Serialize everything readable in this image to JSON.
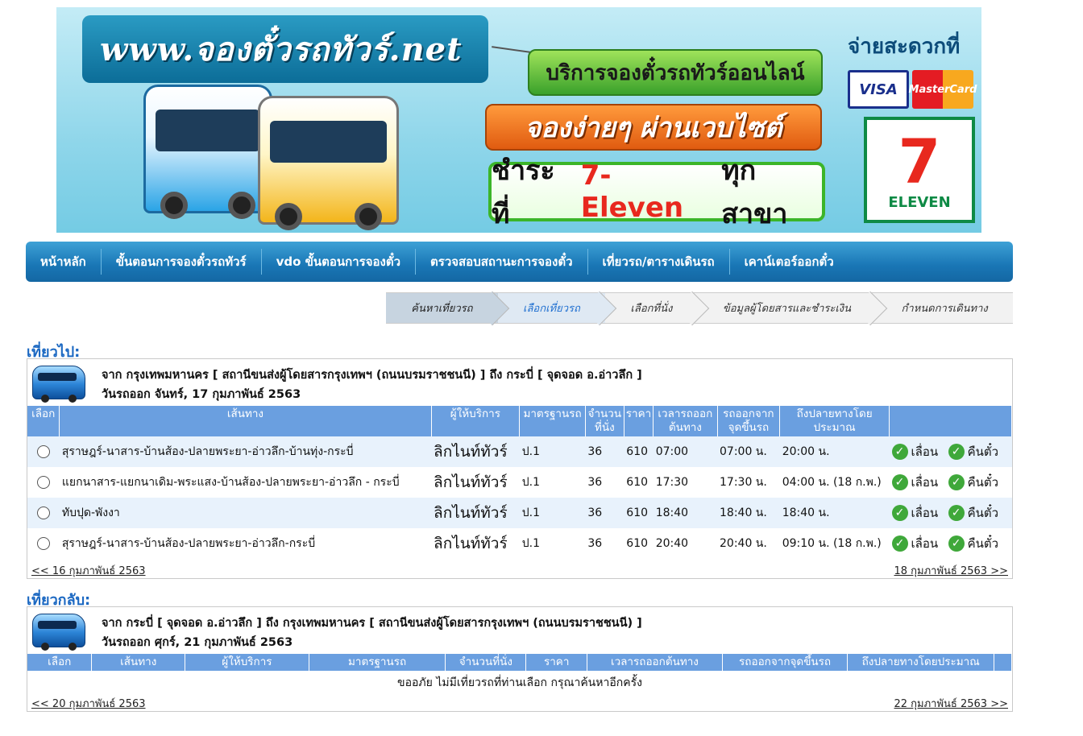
{
  "banner": {
    "url_text": "www.จองตั๋วรถทัวร์.net",
    "service_text": "บริการจองตั๋วรถทัวร์ออนไลน์",
    "easy_text": "จองง่ายๆ ผ่านเวบไซต์",
    "pay_prefix": "ชำระที่",
    "pay_brand": "7-Eleven",
    "pay_suffix": "ทุกสาขา",
    "convenient_text": "จ่ายสะดวกที่",
    "visa": "VISA",
    "mastercard": "MasterCard",
    "seven_number": "7",
    "seven_text": "ELEVEN"
  },
  "nav": [
    "หน้าหลัก",
    "ขั้นตอนการจองตั๋วรถทัวร์",
    "vdo ขั้นตอนการจองตั๋ว",
    "ตรวจสอบสถานะการจองตั๋ว",
    "เที่ยวรถ/ตารางเดินรถ",
    "เคาน์เตอร์ออกตั๋ว"
  ],
  "steps": [
    "ค้นหาเที่ยวรถ",
    "เลือกเที่ยวรถ",
    "เลือกที่นั่ง",
    "ข้อมูลผู้โดยสารและชำระเงิน",
    "กำหนดการเดินทาง"
  ],
  "outbound": {
    "title": "เที่ยวไป:",
    "route": "จาก กรุงเทพมหานคร [ สถานีขนส่งผู้โดยสารกรุงเทพฯ (ถนนบรมราชชนนี) ] ถึง กระบี่ [ จุดจอด อ.อ่าวลึก ]",
    "date": "วันรถออก จันทร์, 17 กุมภาพันธ์ 2563",
    "headers": {
      "select": "เลือก",
      "route": "เส้นทาง",
      "provider": "ผู้ให้บริการ",
      "standard": "มาตรฐานรถ",
      "seats": "จำนวนที่นั่ง",
      "price": "ราคา",
      "depart": "เวลารถออกต้นทาง",
      "boarding": "รถออกจากจุดขึ้นรถ",
      "arrive": "ถึงปลายทางโดยประมาณ"
    },
    "rows": [
      {
        "route": "สุราษฎร์-นาสาร-บ้านส้อง-ปลายพระยา-อ่าวลึก-บ้านทุ่ง-กระบี่",
        "provider": "ลิกไนท์ทัวร์",
        "standard": "ป.1",
        "seats": "36",
        "price": "610",
        "depart": "07:00",
        "boarding": "07:00 น.",
        "arrive": "20:00 น.",
        "move": "เลื่อน",
        "refund": "คืนตั๋ว"
      },
      {
        "route": "แยกนาสาร-แยกนาเดิม-พระแสง-บ้านส้อง-ปลายพระยา-อ่าวลึก - กระบี่",
        "provider": "ลิกไนท์ทัวร์",
        "standard": "ป.1",
        "seats": "36",
        "price": "610",
        "depart": "17:30",
        "boarding": "17:30 น.",
        "arrive": "04:00 น. (18 ก.พ.)",
        "move": "เลื่อน",
        "refund": "คืนตั๋ว"
      },
      {
        "route": "ทับปุด-พังงา",
        "provider": "ลิกไนท์ทัวร์",
        "standard": "ป.1",
        "seats": "36",
        "price": "610",
        "depart": "18:40",
        "boarding": "18:40 น.",
        "arrive": "18:40 น.",
        "move": "เลื่อน",
        "refund": "คืนตั๋ว"
      },
      {
        "route": "สุราษฎร์-นาสาร-บ้านส้อง-ปลายพระยา-อ่าวลึก-กระบี่",
        "provider": "ลิกไนท์ทัวร์",
        "standard": "ป.1",
        "seats": "36",
        "price": "610",
        "depart": "20:40",
        "boarding": "20:40 น.",
        "arrive": "09:10 น. (18 ก.พ.)",
        "move": "เลื่อน",
        "refund": "คืนตั๋ว"
      }
    ],
    "prev": "<< 16 กุมภาพันธ์ 2563",
    "next": "18 กุมภาพันธ์ 2563 >>"
  },
  "inbound": {
    "title": "เที่ยวกลับ:",
    "route": "จาก กระบี่ [ จุดจอด อ.อ่าวลึก ] ถึง กรุงเทพมหานคร [ สถานีขนส่งผู้โดยสารกรุงเทพฯ (ถนนบรมราชชนนี) ]",
    "date": "วันรถออก ศุกร์, 21 กุมภาพันธ์ 2563",
    "headers": {
      "select": "เลือก",
      "route": "เส้นทาง",
      "provider": "ผู้ให้บริการ",
      "standard": "มาตรฐานรถ",
      "seats": "จำนวนที่นั่ง",
      "price": "ราคา",
      "depart": "เวลารถออกต้นทาง",
      "boarding": "รถออกจากจุดขึ้นรถ",
      "arrive": "ถึงปลายทางโดยประมาณ"
    },
    "empty_message": "ขออภัย ไม่มีเที่ยวรถที่ท่านเลือก กรุณาค้นหาอีกครั้ง",
    "prev": "<< 20 กุมภาพันธ์ 2563",
    "next": "22 กุมภาพันธ์ 2563 >>"
  }
}
